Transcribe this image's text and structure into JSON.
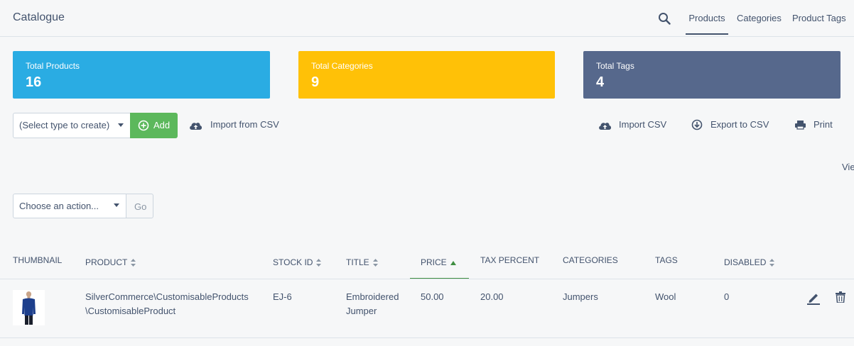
{
  "header": {
    "title": "Catalogue",
    "tabs": [
      {
        "label": "Products",
        "active": true
      },
      {
        "label": "Categories",
        "active": false
      },
      {
        "label": "Product Tags",
        "active": false
      }
    ]
  },
  "stats": [
    {
      "label": "Total Products",
      "value": "16",
      "color": "#2aace3"
    },
    {
      "label": "Total Categories",
      "value": "9",
      "color": "#ffc107"
    },
    {
      "label": "Total Tags",
      "value": "4",
      "color": "#56688c"
    }
  ],
  "toolbar": {
    "create_select": "(Select type to create)",
    "add_label": "Add",
    "import_from_csv": "Import from CSV",
    "import_csv": "Import CSV",
    "export_csv": "Export to CSV",
    "print": "Print",
    "view_cut": "Vie",
    "action_select": "Choose an action...",
    "go_label": "Go"
  },
  "table": {
    "columns": [
      {
        "label": "Thumbnail",
        "sortable": false
      },
      {
        "label": "Product",
        "sortable": true
      },
      {
        "label": "Stock ID",
        "sortable": true
      },
      {
        "label": "Title",
        "sortable": true
      },
      {
        "label": "Price",
        "sortable": true,
        "sorted": "asc"
      },
      {
        "label": "Tax Percent",
        "sortable": false
      },
      {
        "label": "Categories",
        "sortable": false
      },
      {
        "label": "Tags",
        "sortable": false
      },
      {
        "label": "Disabled",
        "sortable": true
      }
    ],
    "rows": [
      {
        "product_line1": "SilverCommerce\\CustomisableProducts",
        "product_line2": "\\CustomisableProduct",
        "stock_id": "EJ-6",
        "title_line1": "Embroidered",
        "title_line2": "Jumper",
        "price": "50.00",
        "tax_percent": "20.00",
        "categories": "Jumpers",
        "tags": "Wool",
        "disabled": "0"
      }
    ]
  },
  "colors": {
    "text": "#43536d",
    "green": "#5cb85c",
    "sort_active": "#3e8e41"
  },
  "icons": [
    "search-icon",
    "plus-circle-icon",
    "cloud-upload-icon",
    "download-circle-icon",
    "printer-icon",
    "sort-icon",
    "sort-asc-icon",
    "pencil-icon",
    "trash-icon"
  ]
}
